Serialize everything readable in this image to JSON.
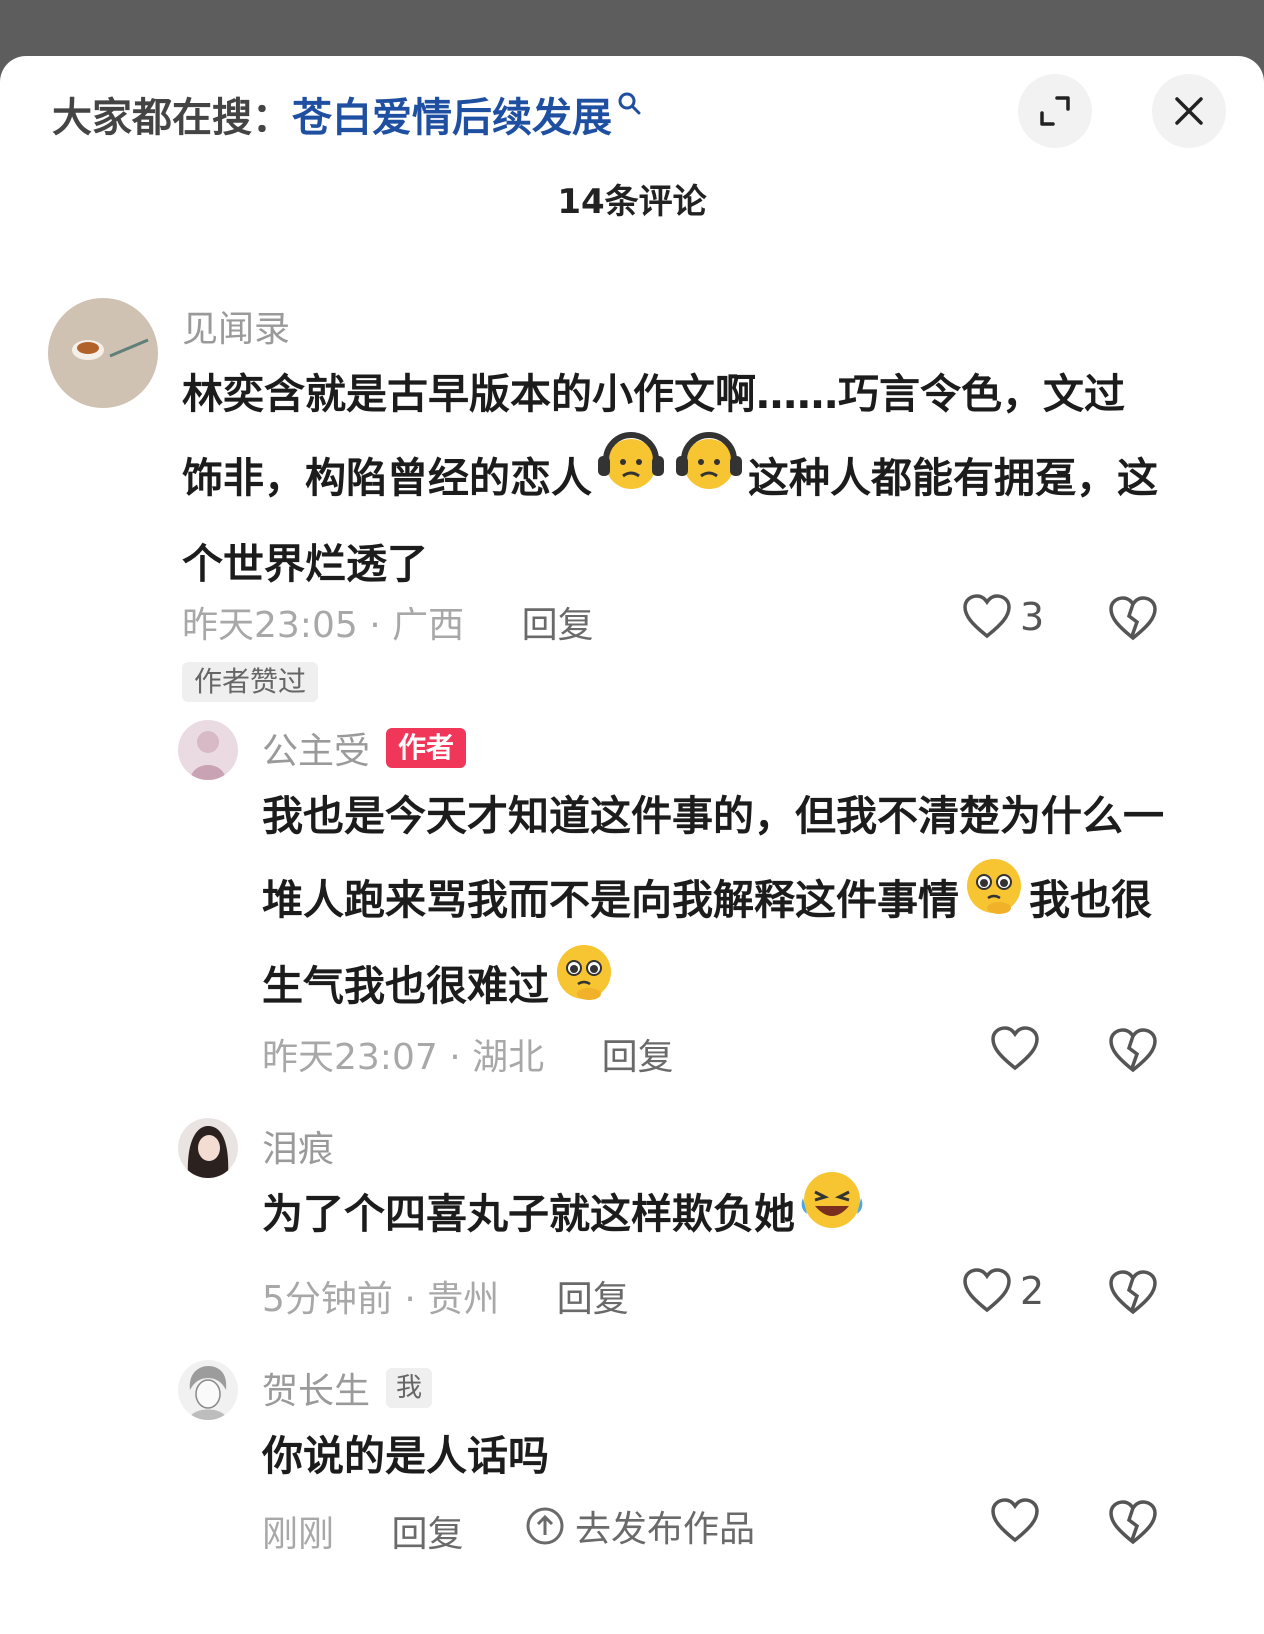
{
  "header": {
    "search_prefix": "大家都在搜：",
    "search_query": "苍白爱情后续发展",
    "comment_count": "14条评论"
  },
  "comments": [
    {
      "username": "见闻录",
      "text_part1": "林奕含就是古早版本的小作文啊……巧言令色，文过饰非，构陷曾经的恋人",
      "text_part2": "这种人都能有拥趸，这个世界烂透了",
      "time": "昨天23:05",
      "location": "广西",
      "reply": "回复",
      "likes": "3",
      "tag": "作者赞过"
    },
    {
      "username": "公主受",
      "badge": "作者",
      "text_part1": "我也是今天才知道这件事的，但我不清楚为什么一堆人跑来骂我而不是向我解释这件事情",
      "text_part2": "我也很生气我也很难过",
      "time": "昨天23:07",
      "location": "湖北",
      "reply": "回复"
    },
    {
      "username": "泪痕",
      "text_part1": "为了个四喜丸子就这样欺负她",
      "time": "5分钟前",
      "location": "贵州",
      "reply": "回复",
      "likes": "2"
    },
    {
      "username": "贺长生",
      "badge": "我",
      "text_part1": "你说的是人话吗",
      "time": "刚刚",
      "reply": "回复",
      "publish": "去发布作品"
    }
  ],
  "separator": "·",
  "colors": {
    "search_query": "#1f4fa0",
    "author_badge": "#f0375a",
    "meta_text": "#a8a8a8"
  }
}
